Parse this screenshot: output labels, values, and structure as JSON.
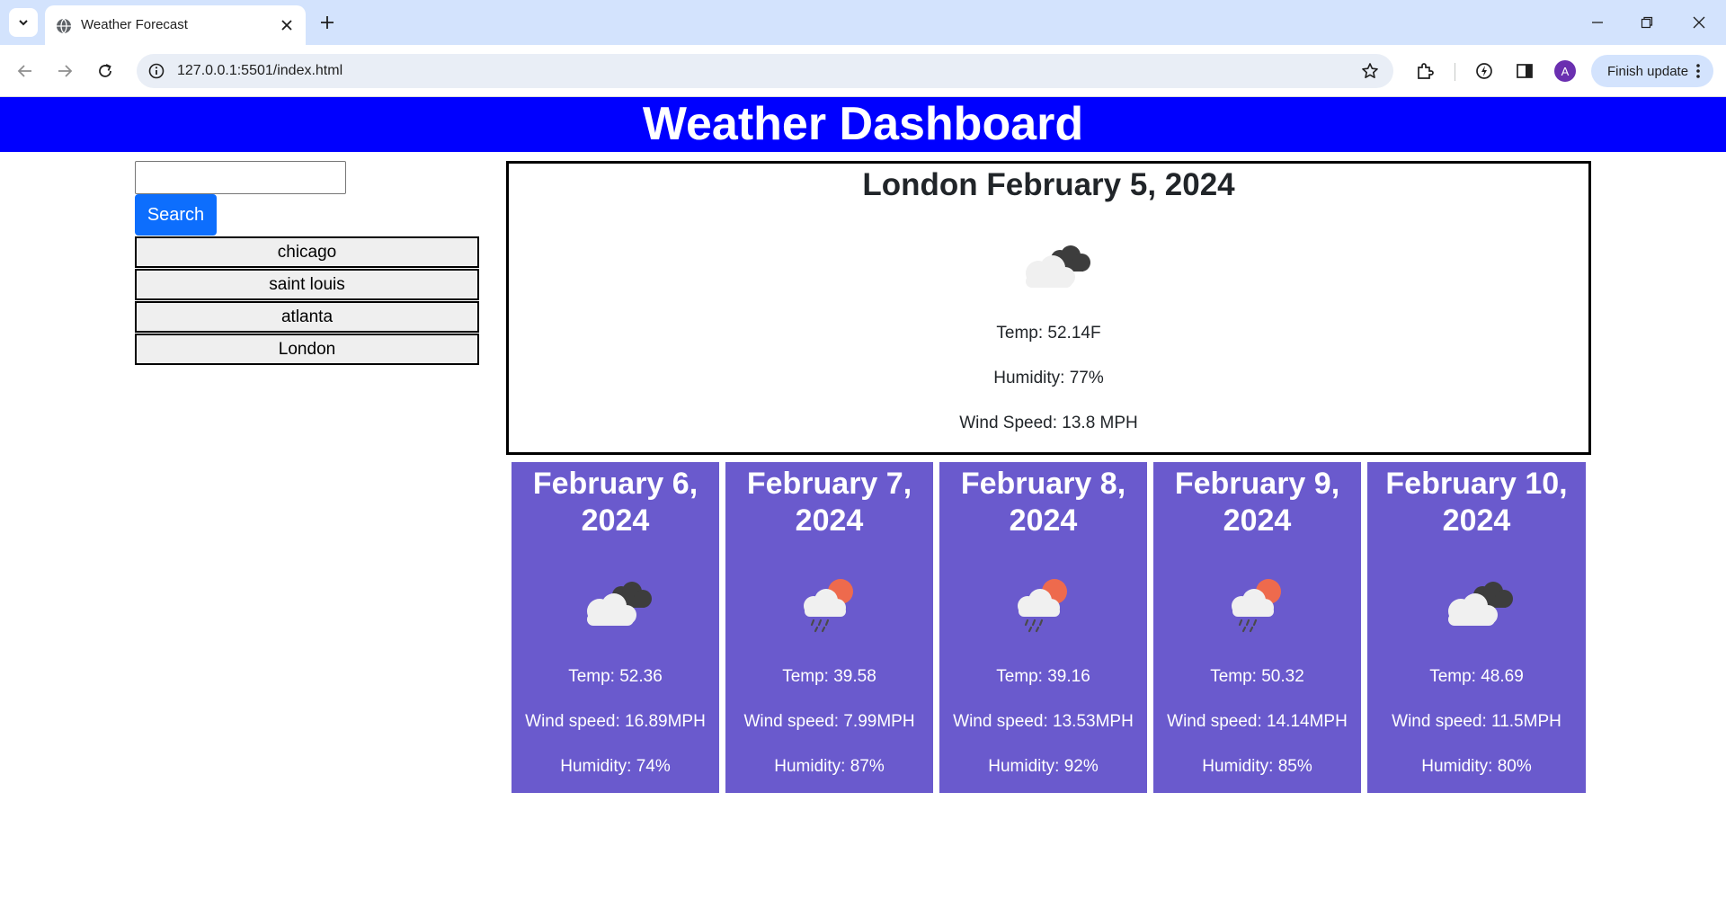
{
  "browser": {
    "tab_title": "Weather Forecast",
    "url": "127.0.0.1:5501/index.html",
    "profile_initial": "A",
    "finish_update_label": "Finish update"
  },
  "page": {
    "heading": "Weather Dashboard",
    "search": {
      "input_value": "",
      "button_label": "Search"
    },
    "history": [
      "chicago",
      "saint louis",
      "atlanta",
      "London"
    ],
    "current": {
      "title": "London February 5, 2024",
      "icon": "broken-clouds-icon",
      "temp": "Temp: 52.14F",
      "humidity": "Humidity: 77%",
      "wind": "Wind Speed: 13.8 MPH"
    },
    "forecast": [
      {
        "date": "February 6, 2024",
        "icon": "broken-clouds-icon",
        "temp": "Temp: 52.36",
        "wind": "Wind speed: 16.89MPH",
        "humidity": "Humidity: 74%"
      },
      {
        "date": "February 7, 2024",
        "icon": "rain-icon",
        "temp": "Temp: 39.58",
        "wind": "Wind speed: 7.99MPH",
        "humidity": "Humidity: 87%"
      },
      {
        "date": "February 8, 2024",
        "icon": "rain-icon",
        "temp": "Temp: 39.16",
        "wind": "Wind speed: 13.53MPH",
        "humidity": "Humidity: 92%"
      },
      {
        "date": "February 9, 2024",
        "icon": "rain-icon",
        "temp": "Temp: 50.32",
        "wind": "Wind speed: 14.14MPH",
        "humidity": "Humidity: 85%"
      },
      {
        "date": "February 10, 2024",
        "icon": "broken-clouds-icon",
        "temp": "Temp: 48.69",
        "wind": "Wind speed: 11.5MPH",
        "humidity": "Humidity: 80%"
      }
    ]
  },
  "colors": {
    "header_bg": "#0000ff",
    "forecast_bg": "#6a5acd",
    "search_button": "#0d6efd",
    "tabbar_bg": "#d3e3fd"
  }
}
